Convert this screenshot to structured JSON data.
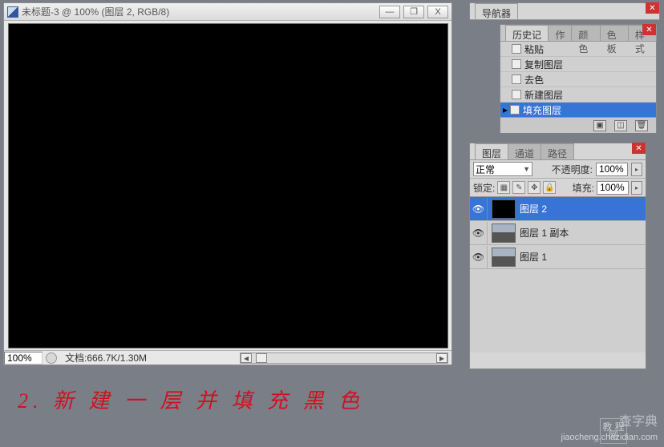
{
  "doc": {
    "title": "未标题-3 @ 100% (图层 2, RGB/8)",
    "zoom": "100%",
    "info": "文档:666.7K/1.30M"
  },
  "win_btns": {
    "min": "—",
    "max": "❐",
    "close": "X"
  },
  "nav": {
    "tab": "导航器"
  },
  "history": {
    "tab": "历史记录",
    "extra_tabs": [
      "作",
      "颜色",
      "色板",
      "样式"
    ],
    "items": [
      {
        "name": "粘贴"
      },
      {
        "name": "复制图层"
      },
      {
        "name": "去色"
      },
      {
        "name": "新建图层"
      },
      {
        "name": "填充图层",
        "selected": true
      }
    ],
    "footer_icons": [
      "snap",
      "new",
      "trash"
    ]
  },
  "layers": {
    "tabs": [
      "图层",
      "通道",
      "路径"
    ],
    "blend": "正常",
    "opacity_label": "不透明度:",
    "opacity_val": "100%",
    "lock_label": "锁定:",
    "fill_label": "填充:",
    "fill_val": "100%",
    "items": [
      {
        "name": "图层 2",
        "selected": true,
        "thumb": "black"
      },
      {
        "name": "图层 1 副本",
        "thumb": "img"
      },
      {
        "name": "图层 1",
        "thumb": "img"
      }
    ]
  },
  "caption": "2. 新 建 一 层 并 填 充 黑 色",
  "watermark": {
    "a": "查字典",
    "b": "jiaocheng.chazidian.com",
    "box1": "教 程",
    "box2": "网"
  }
}
